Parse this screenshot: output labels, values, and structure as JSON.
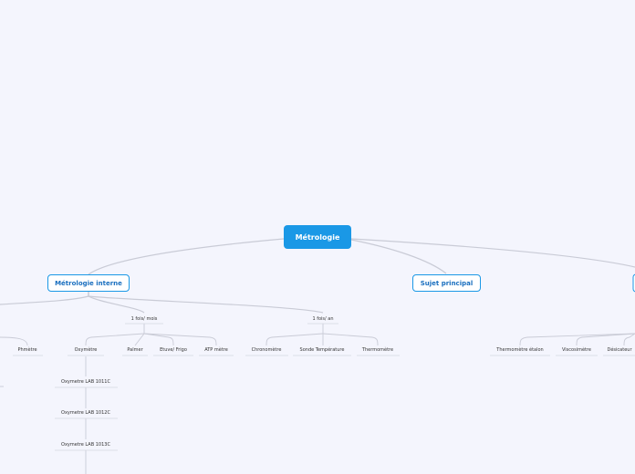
{
  "root": {
    "label": "Métrologie"
  },
  "branches": {
    "interne": "Métrologie interne",
    "sujet": "Sujet principal"
  },
  "groups": {
    "mois": "1 fois/ mois",
    "an": "1 fois/ an"
  },
  "leaves": {
    "phmetre": "Phmètre",
    "oxymetre": "Oxymètre",
    "palmer": "Palmer",
    "etuve": "Etuve/ Frigo",
    "atp": "ATP mètre",
    "chronometre": "Chronomètre",
    "sonde": "Sonde Température",
    "thermometre": "Thermomètre",
    "thermometre_etalon": "Thermomètre étalon",
    "viscosimetre": "Viscosimètre",
    "dessicateur": "Désicateur"
  },
  "oxymetres": [
    "Oxymetre LAB 1011C",
    "Oxymetre LAB 1012C",
    "Oxymetre LAB 1013C"
  ],
  "colors": {
    "accent": "#1a98e6",
    "line": "#c7c9d4",
    "background": "#f4f5fd"
  }
}
